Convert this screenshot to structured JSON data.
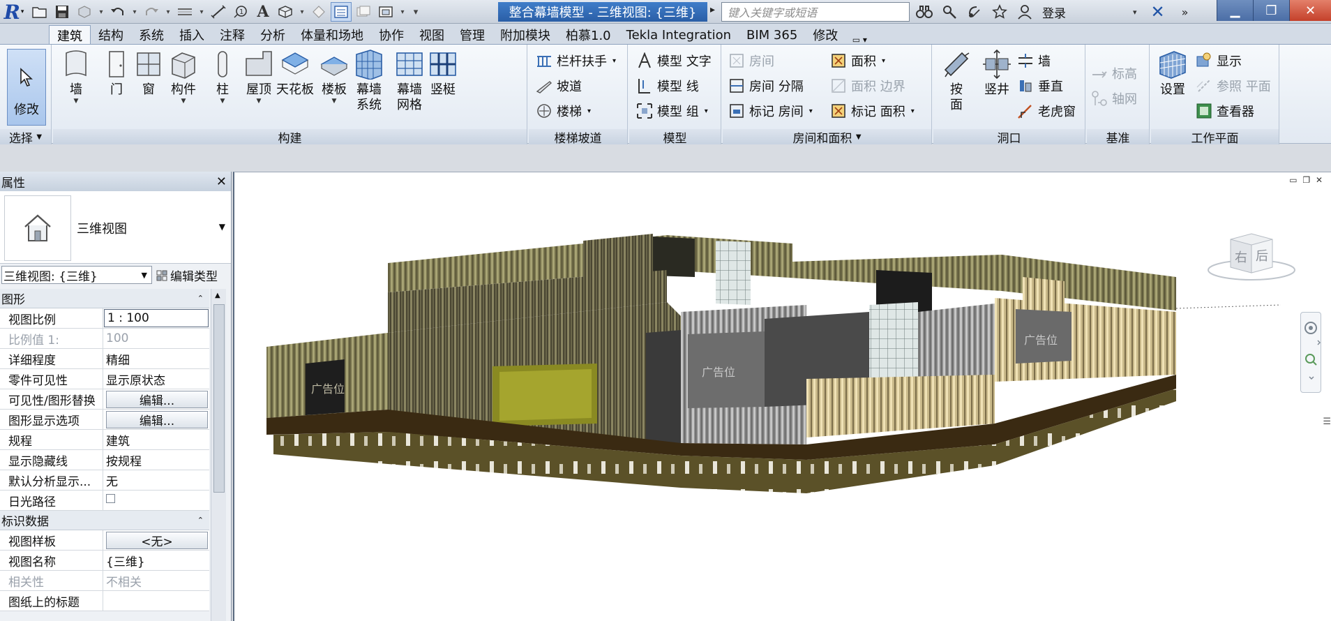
{
  "titlebar": {
    "app_icon": "revit-r-icon",
    "doc_title": "整合幕墙模型 - 三维视图: {三维}",
    "search_placeholder": "键入关键字或短语",
    "login": "登录"
  },
  "tabs": [
    "建筑",
    "结构",
    "系统",
    "插入",
    "注释",
    "分析",
    "体量和场地",
    "协作",
    "视图",
    "管理",
    "附加模块",
    "柏慕1.0",
    "Tekla Integration",
    "BIM 365",
    "修改"
  ],
  "ribbon": {
    "select": {
      "modify": "修改",
      "title": "选择"
    },
    "build": {
      "title": "构建",
      "items": [
        "墙",
        "门",
        "窗",
        "构件",
        "柱",
        "屋顶",
        "天花板",
        "楼板",
        "幕墙\n系统",
        "幕墙\n网格",
        "竖梃"
      ]
    },
    "stairs": {
      "title": "楼梯坡道",
      "railing": "栏杆扶手",
      "ramp": "坡道",
      "stair": "楼梯"
    },
    "model": {
      "title": "模型",
      "text": "模型 文字",
      "line": "模型 线",
      "group": "模型 组"
    },
    "room": {
      "title": "房间和面积",
      "room": "房间",
      "separator": "房间 分隔",
      "tag_room": "标记 房间",
      "area": "面积",
      "area_boundary": "面积 边界",
      "tag_area": "标记 面积"
    },
    "opening": {
      "title": "洞口",
      "by_face": "按\n面",
      "shaft": "竖井",
      "wall": "墙",
      "vertical": "垂直",
      "dormer": "老虎窗"
    },
    "datum": {
      "title": "基准",
      "level": "标高",
      "grid": "轴网"
    },
    "workplane": {
      "title": "工作平面",
      "set": "设置",
      "show": "显示",
      "ref_plane": "参照 平面",
      "viewer": "查看器"
    }
  },
  "properties": {
    "title": "属性",
    "type_name": "三维视图",
    "instance": "三维视图: {三维}",
    "edit_type": "编辑类型",
    "groups": [
      {
        "name": "图形",
        "rows": [
          {
            "key": "视图比例",
            "value": "1 : 100",
            "kind": "input"
          },
          {
            "key": "比例值 1:",
            "value": "100",
            "kind": "disabled"
          },
          {
            "key": "详细程度",
            "value": "精细",
            "kind": "text"
          },
          {
            "key": "零件可见性",
            "value": "显示原状态",
            "kind": "text"
          },
          {
            "key": "可见性/图形替换",
            "value": "编辑...",
            "kind": "button"
          },
          {
            "key": "图形显示选项",
            "value": "编辑...",
            "kind": "button"
          },
          {
            "key": "规程",
            "value": "建筑",
            "kind": "text"
          },
          {
            "key": "显示隐藏线",
            "value": "按规程",
            "kind": "text"
          },
          {
            "key": "默认分析显示...",
            "value": "无",
            "kind": "text"
          },
          {
            "key": "日光路径",
            "value": "",
            "kind": "checkbox"
          }
        ]
      },
      {
        "name": "标识数据",
        "rows": [
          {
            "key": "视图样板",
            "value": "<无>",
            "kind": "button"
          },
          {
            "key": "视图名称",
            "value": "{三维}",
            "kind": "text"
          },
          {
            "key": "相关性",
            "value": "不相关",
            "kind": "disabled"
          },
          {
            "key": "图纸上的标题",
            "value": "",
            "kind": "text"
          }
        ]
      }
    ]
  },
  "viewport": {
    "viewcube": {
      "right": "右",
      "back": "后"
    },
    "billboard_text": "广告位"
  }
}
